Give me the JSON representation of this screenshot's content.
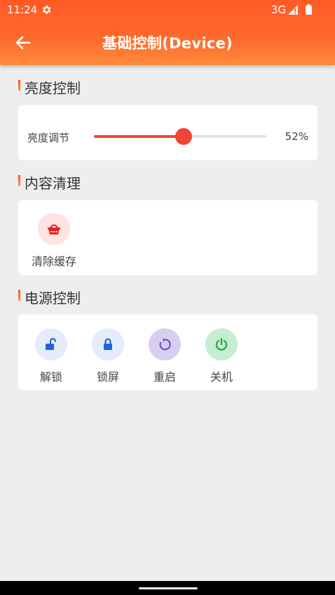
{
  "status_bar": {
    "time": "11:24",
    "network": "3G"
  },
  "header": {
    "title": "基础控制(Device)"
  },
  "brightness": {
    "section_title": "亮度控制",
    "label": "亮度调节",
    "value": 0.52,
    "value_text": "52%"
  },
  "content": {
    "section_title": "内容清理",
    "items": [
      {
        "label": "清除缓存",
        "icon": "broom-basket-icon"
      }
    ]
  },
  "power": {
    "section_title": "电源控制",
    "items": [
      {
        "label": "解锁",
        "icon": "unlock-icon"
      },
      {
        "label": "锁屏",
        "icon": "lock-icon"
      },
      {
        "label": "重启",
        "icon": "restart-icon"
      },
      {
        "label": "关机",
        "icon": "power-icon"
      }
    ]
  },
  "colors": {
    "accent": "#ff5a26",
    "slider": "#ee4536",
    "clear_icon": "#e8201b",
    "lock_icon": "#1e62e0",
    "restart_icon": "#6a56c8",
    "power_icon": "#27a84a"
  }
}
